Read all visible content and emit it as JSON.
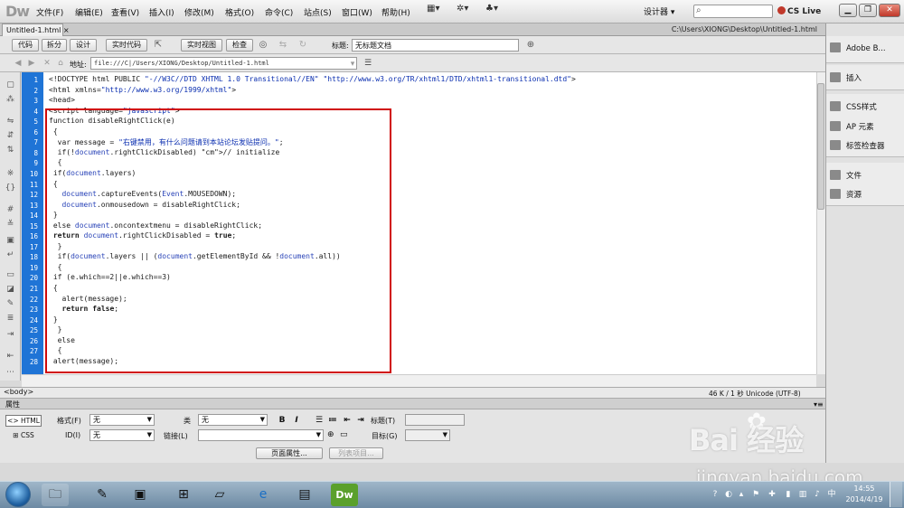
{
  "app": {
    "logo": "Dw"
  },
  "menus": [
    "文件(F)",
    "编辑(E)",
    "查看(V)",
    "插入(I)",
    "修改(M)",
    "格式(O)",
    "命令(C)",
    "站点(S)",
    "窗口(W)",
    "帮助(H)"
  ],
  "topright": {
    "workspace": "设计器 ▾",
    "search_placeholder": "",
    "cslive": "CS Live"
  },
  "document": {
    "tab": "Untitled-1.html",
    "path": "C:\\Users\\XIONG\\Desktop\\Untitled-1.html"
  },
  "toolbar": {
    "code": "代码",
    "split": "拆分",
    "design": "设计",
    "live_code": "实时代码",
    "live_view": "实时视图",
    "inspect": "检查",
    "title_label": "标题:",
    "title_value": "无标题文档"
  },
  "address": {
    "label": "地址:",
    "value": "file:///C|/Users/XIONG/Desktop/Untitled-1.html"
  },
  "code_lines": [
    {
      "n": "1",
      "text": "<!DOCTYPE html PUBLIC \"-//W3C//DTD XHTML 1.0 Transitional//EN\" \"http://www.w3.org/TR/xhtml1/DTD/xhtml1-transitional.dtd\">"
    },
    {
      "n": "2",
      "text": "<html xmlns=\"http://www.w3.org/1999/xhtml\">"
    },
    {
      "n": "3",
      "text": "<head>"
    },
    {
      "n": "4",
      "text": "<script language=\"javascript\">"
    },
    {
      "n": "5",
      "text": "function disableRightClick(e)"
    },
    {
      "n": "6",
      "text": " {"
    },
    {
      "n": "7",
      "text": "  var message = \"右键禁用，有什么问题请到本站论坛发贴提问。\";"
    },
    {
      "n": "8",
      "text": "  if(!document.rightClickDisabled) // initialize"
    },
    {
      "n": "9",
      "text": "  {"
    },
    {
      "n": "10",
      "text": " if(document.layers)"
    },
    {
      "n": "11",
      "text": " {"
    },
    {
      "n": "12",
      "text": "   document.captureEvents(Event.MOUSEDOWN);"
    },
    {
      "n": "13",
      "text": "   document.onmousedown = disableRightClick;"
    },
    {
      "n": "14",
      "text": " }"
    },
    {
      "n": "15",
      "text": " else document.oncontextmenu = disableRightClick;"
    },
    {
      "n": "16",
      "text": " return document.rightClickDisabled = true;"
    },
    {
      "n": "17",
      "text": "  }"
    },
    {
      "n": "18",
      "text": "  if(document.layers || (document.getElementById && !document.all))"
    },
    {
      "n": "19",
      "text": "  {"
    },
    {
      "n": "20",
      "text": " if (e.which==2||e.which==3)"
    },
    {
      "n": "21",
      "text": " {"
    },
    {
      "n": "22",
      "text": "   alert(message);"
    },
    {
      "n": "23",
      "text": "   return false;"
    },
    {
      "n": "24",
      "text": " }"
    },
    {
      "n": "25",
      "text": "  }"
    },
    {
      "n": "26",
      "text": "  else"
    },
    {
      "n": "27",
      "text": "  {"
    },
    {
      "n": "28",
      "text": " alert(message);"
    }
  ],
  "status": {
    "tag": "<body>",
    "info": "46 K / 1 秒 Unicode (UTF-8)"
  },
  "properties": {
    "header": "属性",
    "html": "HTML",
    "css": "CSS",
    "format_label": "格式(F)",
    "format_value": "无",
    "class_label": "类",
    "class_value": "无",
    "id_label": "ID(I)",
    "id_value": "无",
    "link_label": "链接(L)",
    "link_value": "",
    "title_label": "标题(T)",
    "target_label": "目标(G)",
    "page_props": "页面属性...",
    "list_item": "列表项目..."
  },
  "right_panel": {
    "group1": [
      "Adobe B..."
    ],
    "group2": [
      "插入"
    ],
    "group3": [
      "CSS样式",
      "AP 元素",
      "标签检查器"
    ],
    "group4": [
      "文件",
      "资源"
    ]
  },
  "watermark": {
    "brand": "Bai 经验",
    "url": "jingyan.baidu.com"
  },
  "taskbar": {
    "time": "14:55",
    "date": "2014/4/19"
  },
  "colors": {
    "gutter": "#1f74d6",
    "highlight_box": "#d00a0a",
    "string": "#0b2fb0"
  }
}
